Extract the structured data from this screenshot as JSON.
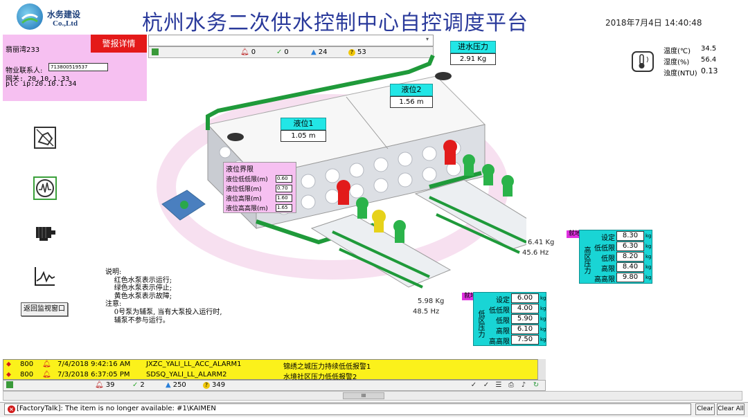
{
  "header": {
    "logo_cn": "水务建设",
    "logo_en": "Co.,Ltd",
    "title": "杭州水务二次供水控制中心自控调度平台",
    "datetime": "2018年7月4日 14:40:48"
  },
  "info": {
    "site": "翡丽湾233",
    "alarm_button": "警报详情",
    "contact_label": "物业联系人:",
    "contact_value": "713800519537",
    "gateway": "网关: 20.10.1.33",
    "plc_ip": "plc ip:20.10.1.34"
  },
  "top_alarm_stats": {
    "alarms": "0",
    "acks": "0",
    "warnings": "24",
    "queries": "53"
  },
  "inlet": {
    "title": "进水压力",
    "value": "2.91 Kg"
  },
  "level1": {
    "title": "液位1",
    "value": "1.05 m"
  },
  "level2": {
    "title": "液位2",
    "value": "1.56 m"
  },
  "level_limits": {
    "title": "液位界限",
    "rows": [
      {
        "label": "液位低低限(m)",
        "value": "0.60"
      },
      {
        "label": "液位低限(m)",
        "value": "0.70"
      },
      {
        "label": "液位高限(m)",
        "value": "1.60"
      },
      {
        "label": "液位高高限(m)",
        "value": "1.65"
      }
    ]
  },
  "environment": {
    "temp_label": "温度(℃)",
    "temp_value": "34.5",
    "humidity_label": "湿度(%)",
    "humidity_value": "56.4",
    "turbidity_label": "浊度(NTU)",
    "turbidity_value": "0.13"
  },
  "pump_readings": {
    "high_pressure": "6.41 Kg",
    "high_freq": "45.6 Hz",
    "low_pressure": "5.98 Kg",
    "low_freq": "48.5 Hz"
  },
  "high_zone": {
    "tag": "就地",
    "name": "高区压力",
    "unit": "kg",
    "rows": [
      {
        "label": "设定",
        "value": "8.30"
      },
      {
        "label": "低低限",
        "value": "6.30"
      },
      {
        "label": "低限",
        "value": "8.20"
      },
      {
        "label": "高限",
        "value": "8.40"
      },
      {
        "label": "高高限",
        "value": "9.80"
      }
    ]
  },
  "low_zone": {
    "tag": "就地",
    "name": "低区压力",
    "unit": "kg",
    "rows": [
      {
        "label": "设定",
        "value": "6.00"
      },
      {
        "label": "低低限",
        "value": "4.00"
      },
      {
        "label": "低限",
        "value": "5.90"
      },
      {
        "label": "高限",
        "value": "6.10"
      },
      {
        "label": "高高限",
        "value": "7.50"
      }
    ]
  },
  "notes": {
    "text": "说明:\n    红色水泵表示运行;\n    绿色水泵表示停止;\n    黄色水泵表示故障;\n注意:\n    0号泵为辅泵, 当有大泵投入运行时,\n    辅泵不参与运行。"
  },
  "return_button": "返回监视窗口",
  "alarm_list": [
    {
      "priority": "800",
      "time": "7/4/2018 9:42:16 AM",
      "tag": "JXZC_YALI_LL_ACC_ALARM1",
      "message": "锦绣之城压力持续低低报警1"
    },
    {
      "priority": "800",
      "time": "7/3/2018 6:37:05 PM",
      "tag": "SDSQ_YALI_LL_ALARM2",
      "message": "水境社区压力低低报警2"
    }
  ],
  "bottom_stats": {
    "alarms": "39",
    "acks": "2",
    "warnings": "250",
    "queries": "349"
  },
  "hscroll_label": "III",
  "status": {
    "message": "[FactoryTalk]: The item is no longer available: #1\\KAIMEN",
    "clear": "Clear",
    "clear_all": "Clear All"
  },
  "colors": {
    "title_blue": "#2a3a9b",
    "cyan": "#22e6e6",
    "pink": "#f6c0f1",
    "alarm_yellow": "#fbf11b",
    "pipe_green": "#1f9a3a"
  }
}
